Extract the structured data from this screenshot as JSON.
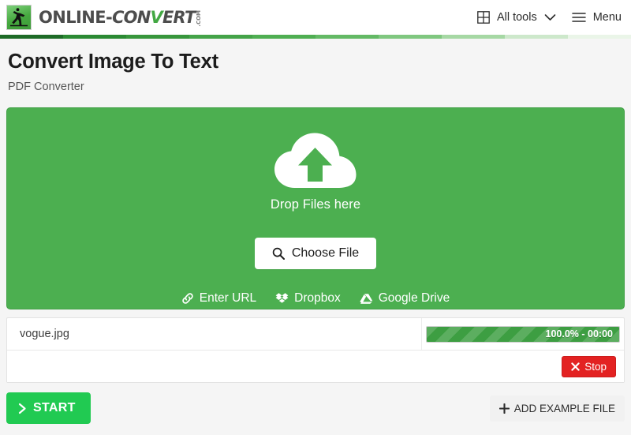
{
  "header": {
    "logo": {
      "icon": "running-man-logo-icon",
      "word_part1": "ONLINE-",
      "word_part2_pre": "CON",
      "word_part2_hl": "V",
      "word_part2_post": "ERT",
      "tld": ".COM"
    },
    "nav": [
      {
        "icon": "grid-icon",
        "label": "All tools",
        "chevron": "chevron-down-icon"
      },
      {
        "icon": "hamburger-icon",
        "label": "Menu"
      }
    ]
  },
  "gradient_rule": {
    "colors": [
      "#1e6b27",
      "#2b8a33",
      "#37963c",
      "#44a348",
      "#4fae52",
      "#63b965",
      "#7fc77f",
      "#a6d8a4",
      "#cde8cb",
      "#eaf5e8"
    ]
  },
  "title": {
    "heading": "Convert Image To Text",
    "subheading": "PDF Converter"
  },
  "dropzone": {
    "icon": "cloud-upload-icon",
    "drop_text": "Drop Files here",
    "choose_file": {
      "icon": "search-icon",
      "label": "Choose File"
    },
    "sources": [
      {
        "icon": "link-icon",
        "label": "Enter URL"
      },
      {
        "icon": "dropbox-icon",
        "label": "Dropbox"
      },
      {
        "icon": "google-drive-icon",
        "label": "Google Drive"
      }
    ],
    "background_color": "#4caf50"
  },
  "file_table": {
    "rows": [
      {
        "filename": "vogue.jpg",
        "progress_percent": 100,
        "progress_label": "100.0% - 00:00"
      }
    ],
    "stop_button": {
      "icon": "close-x-icon",
      "label": "Stop",
      "color": "#e32222"
    }
  },
  "footer": {
    "start_button": {
      "icon": "chevron-right-icon",
      "label": "START",
      "color": "#21ca52"
    },
    "add_example_button": {
      "icon": "plus-icon",
      "label": "ADD EXAMPLE FILE"
    }
  }
}
